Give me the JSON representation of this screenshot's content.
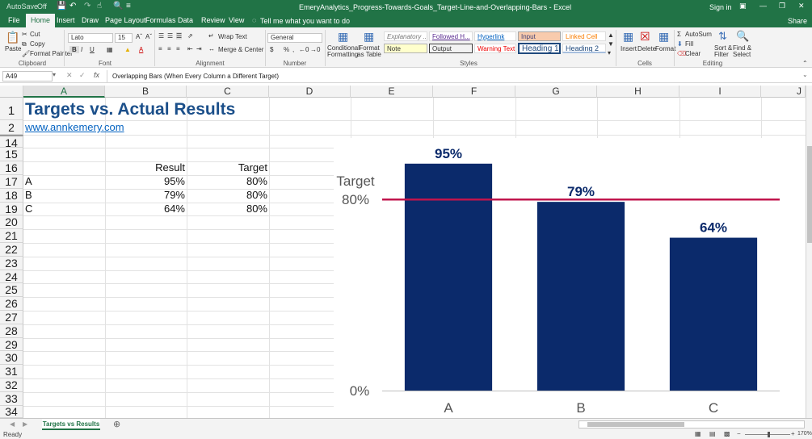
{
  "titlebar": {
    "autosave": "AutoSave",
    "autosave_state": "Off",
    "title": "EmeryAnalytics_Progress-Towards-Goals_Target-Line-and-Overlapping-Bars  -  Excel",
    "signin": "Sign in"
  },
  "tabs": [
    "File",
    "Home",
    "Insert",
    "Draw",
    "Page Layout",
    "Formulas",
    "Data",
    "Review",
    "View"
  ],
  "tellme": "Tell me what you want to do",
  "share": "Share",
  "ribbon": {
    "clipboard": {
      "paste": "Paste",
      "cut": "Cut",
      "copy": "Copy",
      "format_painter": "Format Painter",
      "label": "Clipboard"
    },
    "font": {
      "name": "Lato",
      "size": "15",
      "label": "Font"
    },
    "alignment": {
      "wrap": "Wrap Text",
      "merge": "Merge & Center",
      "label": "Alignment"
    },
    "number": {
      "format": "General",
      "label": "Number"
    },
    "styles": {
      "conditional": "Conditional Formatting",
      "format_table": "Format as Table",
      "cells": [
        "Explanatory ...",
        "Followed H...",
        "Hyperlink",
        "Input",
        "Linked Cell",
        "Note",
        "Output",
        "Warning Text",
        "Heading 1",
        "Heading 2"
      ],
      "label": "Styles"
    },
    "cells": {
      "insert": "Insert",
      "delete": "Delete",
      "format": "Format",
      "label": "Cells"
    },
    "editing": {
      "autosum": "AutoSum",
      "fill": "Fill",
      "clear": "Clear",
      "sort": "Sort & Filter",
      "find": "Find & Select",
      "label": "Editing"
    }
  },
  "formula_bar": {
    "name_box": "A49",
    "fx": "fx",
    "content": "Overlapping Bars (When Every Column a Different Target)"
  },
  "columns": [
    "A",
    "B",
    "C",
    "D",
    "E",
    "F",
    "G",
    "H",
    "I",
    "J"
  ],
  "rows": [
    "1",
    "2",
    "14",
    "15",
    "16",
    "17",
    "18",
    "19",
    "20",
    "21",
    "22",
    "23",
    "24",
    "25",
    "26",
    "27",
    "28",
    "29",
    "30",
    "31",
    "32",
    "33",
    "34"
  ],
  "sheet": {
    "title": "Targets vs. Actual Results",
    "link": "www.annkemery.com",
    "headers": {
      "result": "Result",
      "target": "Target"
    },
    "table": [
      {
        "label": "A",
        "result": "95%",
        "target": "80%"
      },
      {
        "label": "B",
        "result": "79%",
        "target": "80%"
      },
      {
        "label": "C",
        "result": "64%",
        "target": "80%"
      }
    ]
  },
  "chart_data": {
    "type": "bar",
    "categories": [
      "A",
      "B",
      "C"
    ],
    "values": [
      95,
      79,
      64
    ],
    "data_labels": [
      "95%",
      "79%",
      "64%"
    ],
    "target": {
      "label": "Target",
      "value": 80,
      "value_label": "80%"
    },
    "ylim": [
      0,
      100
    ],
    "y_tick_labels": [
      {
        "value": 0,
        "label": "0%"
      }
    ],
    "bar_color": "#0b2a6b",
    "target_color": "#c0144c",
    "grid": false,
    "legend": "none"
  },
  "sheet_tabs": {
    "active": "Targets vs Results"
  },
  "status": {
    "ready": "Ready",
    "zoom": "170%"
  }
}
